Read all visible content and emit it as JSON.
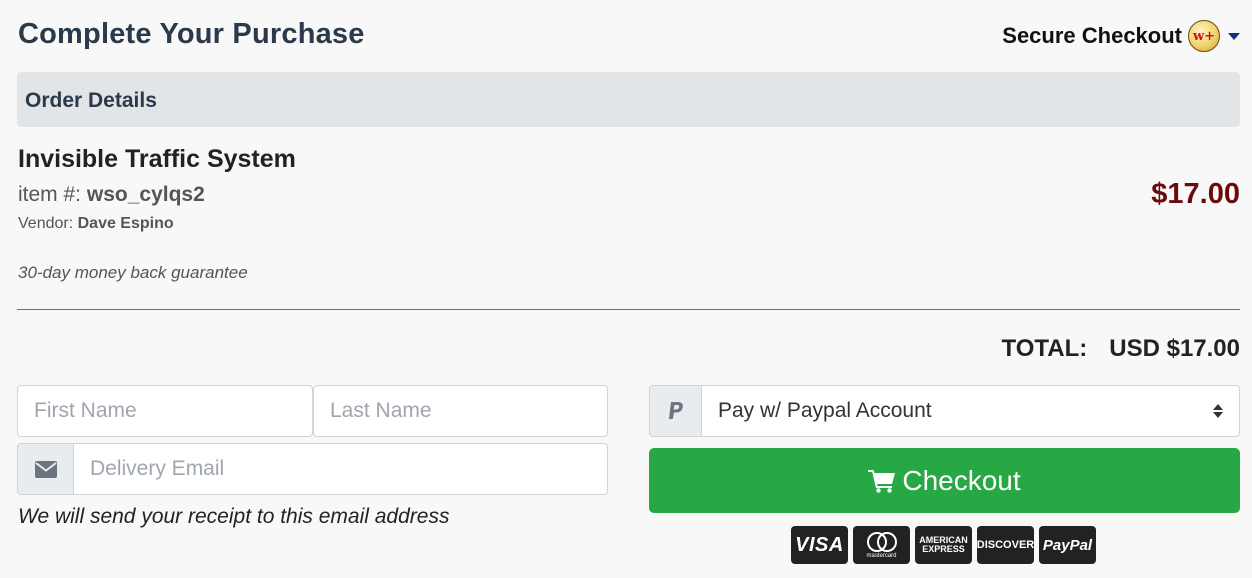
{
  "header": {
    "title": "Complete Your Purchase",
    "secure_label": "Secure Checkout",
    "logo_text": "w+",
    "icons": {
      "logo": "w-plus-logo-icon",
      "caret": "chevron-down-icon"
    }
  },
  "order": {
    "section_title": "Order Details",
    "product_name": "Invisible Traffic System",
    "item_prefix": "item #:",
    "item_id": "wso_cylqs2",
    "vendor_prefix": "Vendor:",
    "vendor_name": "Dave Espino",
    "price": "$17.00",
    "guarantee": "30-day money back guarantee",
    "total_label": "TOTAL:",
    "total_value": "USD $17.00"
  },
  "form": {
    "first_name_placeholder": "First Name",
    "first_name_value": "",
    "last_name_placeholder": "Last Name",
    "last_name_value": "",
    "email_placeholder": "Delivery Email",
    "email_value": "",
    "receipt_note": "We will send your receipt to this email address",
    "icons": {
      "email": "envelope-icon"
    }
  },
  "payment": {
    "method_selected": "Pay w/ Paypal Account",
    "checkout_label": "Checkout",
    "icons": {
      "method": "paypal-icon",
      "checkout": "cart-icon",
      "select": "sort-arrows-icon"
    },
    "cards": {
      "visa": "VISA",
      "mastercard": "mastercard",
      "amex_line1": "AMERICAN",
      "amex_line2": "EXPRESS",
      "discover": "DISCOVER",
      "paypal": "PayPal"
    }
  },
  "colors": {
    "accent_green": "#28a745",
    "price_red": "#6b0a0a",
    "title_navy": "#2b3a4a",
    "header_bar": "#e2e5e8"
  }
}
